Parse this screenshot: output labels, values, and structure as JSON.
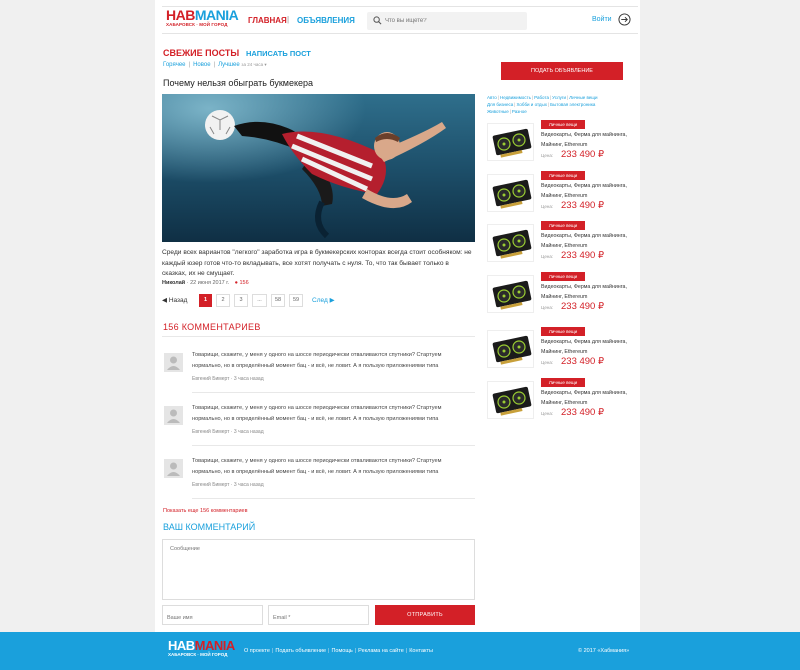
{
  "header": {
    "logo_main": "HAB",
    "logo_accent": "MANIA",
    "logo_sub": "ХАБАРОВСК · МОЙ ГОРОД",
    "nav_home": "Главная",
    "nav_sep": "|",
    "nav_ads": "Объявления",
    "search_placeholder": "Что вы ищете?",
    "login": "Войти"
  },
  "posts": {
    "title": "Свежие посты",
    "write_post": "Написать пост",
    "filters": [
      "Горячее",
      "Новое",
      "Лучшее"
    ],
    "filter_note": "за 24 часа ▾"
  },
  "article": {
    "title": "Почему нельзя обыграть букмекера",
    "text": "Среди всех вариантов \"легкого\" заработка игра в букмекерских конторах всегда стоит особняком: не каждый юзер готов что-то вкладывать, все хотят получать с нуля. То, что так бывает только в сказках, их не смущает.",
    "author": "Николай",
    "date": "· 22 июня 2017 г.",
    "comments_count": "156"
  },
  "pager": {
    "prev": "Назад",
    "next": "След",
    "pages": [
      "1",
      "2",
      "3",
      "...",
      "58",
      "59"
    ]
  },
  "comments": {
    "title": "156 комментариев",
    "items": [
      {
        "text": "Товарищи, скажите, у меня у одного на шоссе периодически отваливаются спутники? Стартуем нормально, но в определённый момент бац - и всё, не ловит. А я пользую приложениями типа",
        "meta": "Евгений Бимерт · 3 часа назад"
      },
      {
        "text": "Товарищи, скажите, у меня у одного на шоссе периодически отваливаются спутники? Стартуем нормально, но в определённый момент бац - и всё, не ловит. А я пользую приложениями типа",
        "meta": "Евгений Бимерт · 3 часа назад"
      },
      {
        "text": "Товарищи, скажите, у меня у одного на шоссе периодически отваливаются спутники? Стартуем нормально, но в определённый момент бац - и всё, не ловит. А я пользую приложениями типа",
        "meta": "Евгений Бимерт · 3 часа назад"
      }
    ],
    "more": "Показать еще 156 комментариев"
  },
  "form": {
    "title": "Ваш комментарий",
    "message_placeholder": "Сообщение",
    "name_placeholder": "Ваше имя",
    "email_placeholder": "Email *",
    "send": "Отправить"
  },
  "sidebar": {
    "post_ad": "Подать объявление",
    "categories": [
      "Авто",
      "Недвижимость",
      "Работа",
      "Услуги",
      "Личные вещи",
      "Для бизнеса",
      "Хобби и отдых",
      "Бытовая электроника",
      "Животные",
      "Разное"
    ],
    "ads": [
      {
        "badge": "Личные вещи",
        "title": "Видеокарты, Ферма для майнинга, Майнинг, Ethereum",
        "price_label": "Цена:",
        "price": "233 490 ₽"
      },
      {
        "badge": "Личные вещи",
        "title": "Видеокарты, Ферма для майнинга, Майнинг, Ethereum",
        "price_label": "Цена:",
        "price": "233 490 ₽"
      },
      {
        "badge": "Личные вещи",
        "title": "Видеокарты, Ферма для майнинга, Майнинг, Ethereum",
        "price_label": "Цена:",
        "price": "233 490 ₽"
      },
      {
        "badge": "Личные вещи",
        "title": "Видеокарты, Ферма для майнинга, Майнинг, Ethereum",
        "price_label": "Цена:",
        "price": "233 490 ₽"
      },
      {
        "badge": "Личные вещи",
        "title": "Видеокарты, Ферма для майнинга, Майнинг, Ethereum",
        "price_label": "Цена:",
        "price": "233 490 ₽"
      },
      {
        "badge": "Личные вещи",
        "title": "Видеокарты, Ферма для майнинга, Майнинг, Ethereum",
        "price_label": "Цена:",
        "price": "233 490 ₽"
      }
    ]
  },
  "footer": {
    "logo_main": "HAB",
    "logo_accent": "MANIA",
    "logo_sub": "ХАБАРОВСК · МОЙ ГОРОД",
    "links": [
      "О проекте",
      "Подать объявление",
      "Помощь",
      "Реклама на сайте",
      "Контакты"
    ],
    "copyright": "© 2017 «Хабмания»"
  },
  "colors": {
    "brand_red": "#d32027",
    "brand_blue": "#1aa0dc"
  }
}
